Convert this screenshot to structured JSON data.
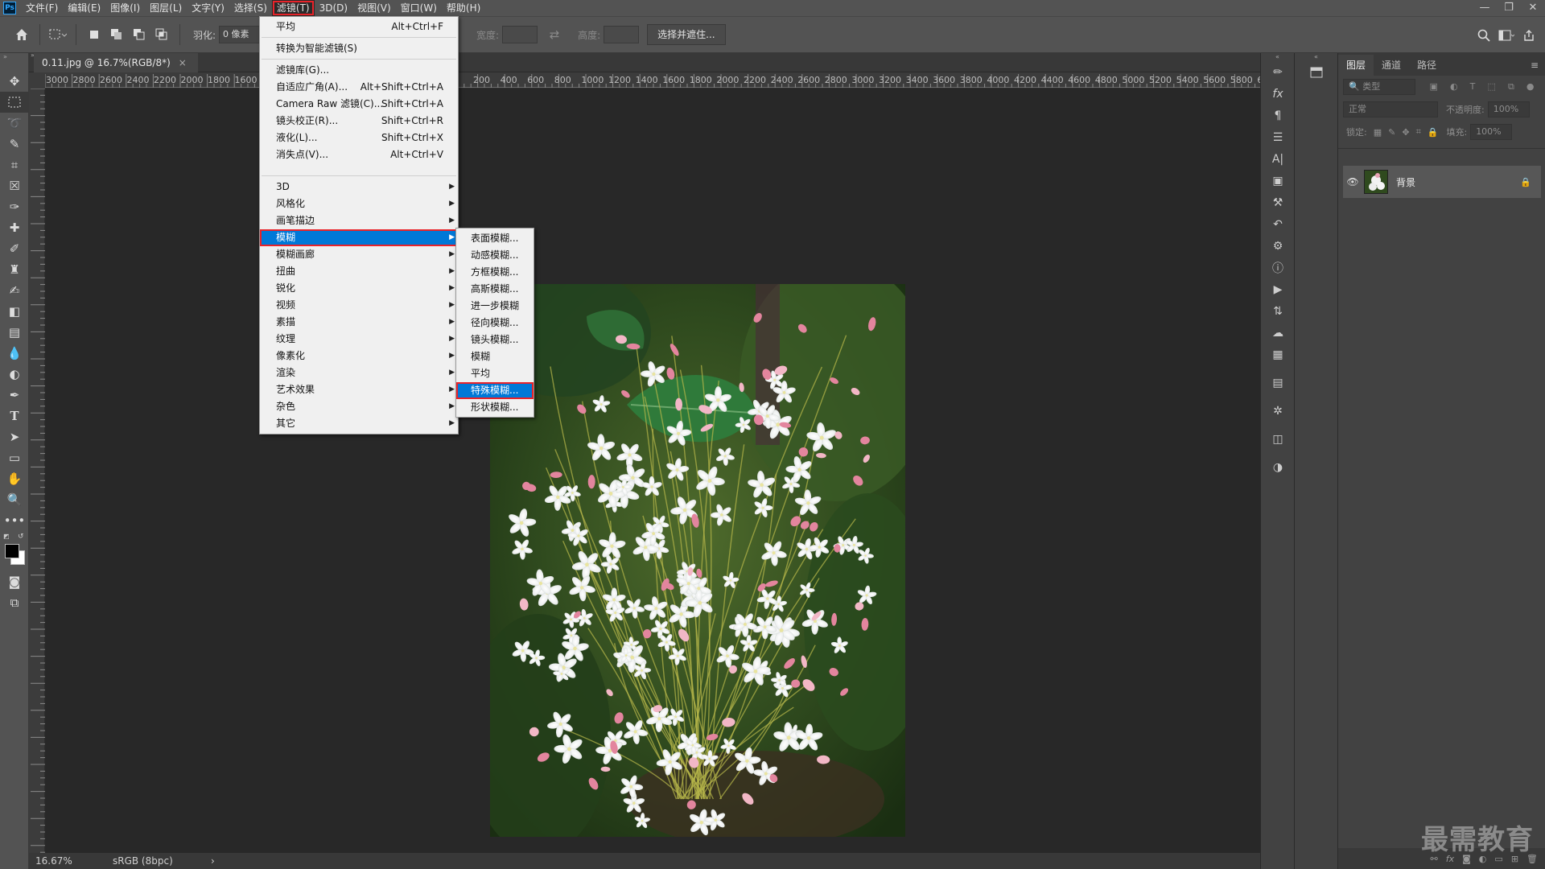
{
  "app": {
    "logo": "Ps"
  },
  "menubar": {
    "items": [
      "文件(F)",
      "编辑(E)",
      "图像(I)",
      "图层(L)",
      "文字(Y)",
      "选择(S)",
      "滤镜(T)",
      "3D(D)",
      "视图(V)",
      "窗口(W)",
      "帮助(H)"
    ],
    "active_item": "滤镜(T)"
  },
  "window_controls": {
    "minimize": "—",
    "restore": "❐",
    "close": "✕"
  },
  "options": {
    "feather_label": "羽化:",
    "feather_value": "0 像素",
    "width_label": "宽度:",
    "height_label": "高度:",
    "select_mask_button": "选择并遮住..."
  },
  "document": {
    "tab_title": "0.11.jpg @ 16.7%(RGB/8*)",
    "tab_close": "×",
    "zoom": "16.67%",
    "color_profile": "sRGB (8bpc)",
    "status_arrow": "›"
  },
  "ruler": {
    "left_labels": [
      "3000",
      "2800",
      "2600",
      "2400",
      "2200",
      "2000",
      "1800",
      "1600"
    ],
    "right_labels": [
      "200",
      "400",
      "600",
      "800",
      "1000",
      "1200",
      "1400",
      "1600",
      "1800",
      "2000",
      "2200",
      "2400",
      "2600",
      "2800",
      "3000",
      "3200",
      "3400",
      "3600",
      "3800",
      "4000",
      "4200",
      "4400",
      "4600",
      "4800",
      "5000",
      "5200",
      "5400",
      "5600",
      "5800",
      "6"
    ]
  },
  "filter_menu": {
    "last_filter": {
      "label": "平均",
      "shortcut": "Alt+Ctrl+F"
    },
    "smart_filter": "转换为智能滤镜(S)",
    "group2": [
      {
        "label": "滤镜库(G)...",
        "shortcut": ""
      },
      {
        "label": "自适应广角(A)...",
        "shortcut": "Alt+Shift+Ctrl+A"
      },
      {
        "label": "Camera Raw 滤镜(C)...",
        "shortcut": "Shift+Ctrl+A"
      },
      {
        "label": "镜头校正(R)...",
        "shortcut": "Shift+Ctrl+R"
      },
      {
        "label": "液化(L)...",
        "shortcut": "Shift+Ctrl+X"
      },
      {
        "label": "消失点(V)...",
        "shortcut": "Alt+Ctrl+V"
      }
    ],
    "submenus": [
      "3D",
      "风格化",
      "画笔描边",
      "模糊",
      "模糊画廊",
      "扭曲",
      "锐化",
      "视频",
      "素描",
      "纹理",
      "像素化",
      "渲染",
      "艺术效果",
      "杂色",
      "其它"
    ],
    "highlighted": "模糊"
  },
  "blur_menu": {
    "items": [
      "表面模糊...",
      "动感模糊...",
      "方框模糊...",
      "高斯模糊...",
      "进一步模糊",
      "径向模糊...",
      "镜头模糊...",
      "模糊",
      "平均",
      "特殊模糊...",
      "形状模糊..."
    ],
    "highlighted": "特殊模糊..."
  },
  "layers_panel": {
    "tabs": [
      "图层",
      "通道",
      "路径"
    ],
    "active_tab": "图层",
    "filter_placeholder": "类型",
    "blend_mode": "正常",
    "opacity_label": "不透明度:",
    "opacity_value": "100%",
    "lock_label": "锁定:",
    "fill_label": "填充:",
    "fill_value": "100%",
    "layer_name": "背景"
  },
  "watermark": "最需教育"
}
